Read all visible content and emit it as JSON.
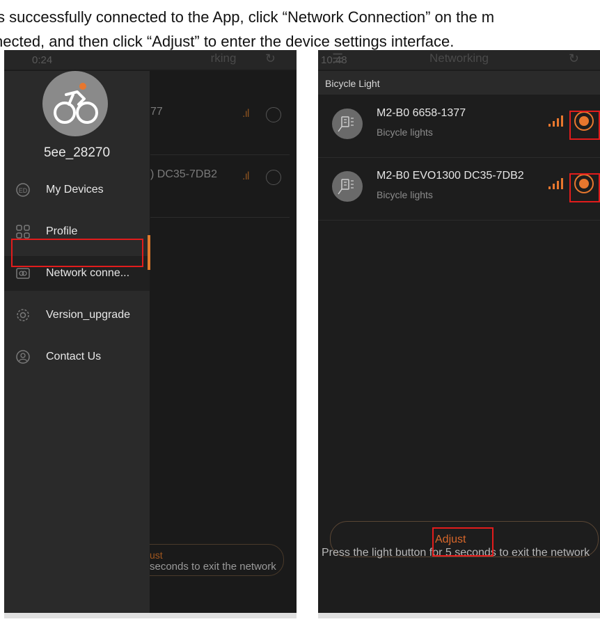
{
  "caption": {
    "line1": "s successfully connected to the App, click “Network Connection” on the m",
    "line2": "nected, and then click “Adjust” to enter the device settings interface."
  },
  "left_screen": {
    "status_time": "0:24",
    "nav_title": "rking",
    "bg_devices": [
      {
        "name": "77"
      },
      {
        "name": ") DC35-7DB2"
      }
    ],
    "bg_adjust_label": "ust",
    "bg_hint": "seconds to exit the network",
    "drawer": {
      "username": "5ee_28270",
      "items": [
        {
          "label": "My Devices",
          "icon": "device-icon"
        },
        {
          "label": "Profile",
          "icon": "grid-icon"
        },
        {
          "label": "Network conne...",
          "icon": "network-icon"
        },
        {
          "label": "Version_upgrade",
          "icon": "gear-icon"
        },
        {
          "label": "Contact Us",
          "icon": "user-icon"
        }
      ],
      "active_index": 2
    }
  },
  "right_screen": {
    "status_time": "10:48",
    "nav_title": "Networking",
    "section_title": "Bicycle Light",
    "devices": [
      {
        "name": "M2-B0 6658-1377",
        "type": "Bicycle lights",
        "selected": true
      },
      {
        "name": "M2-B0 EVO1300 DC35-7DB2",
        "type": "Bicycle lights",
        "selected": true
      }
    ],
    "adjust_label": "Adjust",
    "hint": "Press the light button for 5 seconds to exit the network"
  },
  "colors": {
    "accent": "#e8772e",
    "highlight": "#e21c1c",
    "background": "#1c1c1c"
  }
}
